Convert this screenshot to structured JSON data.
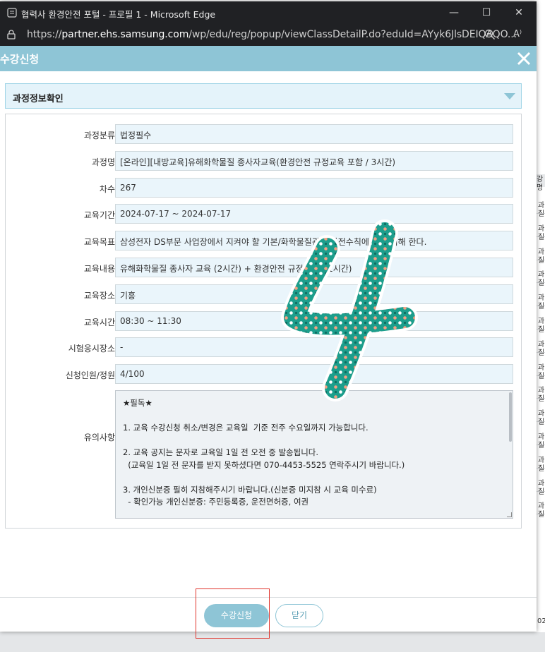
{
  "background": {
    "right_edge_rows": [
      "과질",
      "과질",
      "과질",
      "과질",
      "과질",
      "과질",
      "과질",
      "과질",
      "과질",
      "과질",
      "과질",
      "과질",
      "과질",
      "과질"
    ],
    "right_edge_header": "강명",
    "bottom_right_text": "02"
  },
  "window": {
    "title": "협력사 환경안전 포털 - 프로필 1 - Microsoft Edge",
    "url_prefix": "https://",
    "url_host": "partner.ehs.samsung.com",
    "url_path": "/wp/edu/reg/popup/viewClassDetailP.do?eduId=AYyk6JlsDEIQAQO...",
    "controls": {
      "minimize": "—",
      "maximize": "☐",
      "close": "✕"
    },
    "read_aloud": "A⁾"
  },
  "popup": {
    "title": "수강신청",
    "section_title": "과정정보확인",
    "fields": [
      {
        "label": "과정분류",
        "value": "법정필수"
      },
      {
        "label": "과정명",
        "value": "[온라인][내방교육]유해화학물질 종사자교육(환경안전 규정교육 포함 / 3시간)"
      },
      {
        "label": "차수",
        "value": "267"
      },
      {
        "label": "교육기간",
        "value": "2024-07-17 ~ 2024-07-17"
      },
      {
        "label": "교육목표",
        "value": "삼성전자 DS부문 사업장에서 지켜야 할 기본/화학물질관련 안전수칙에 대해 이해 한다."
      },
      {
        "label": "교육내용",
        "value": "유해화학물질 종사자 교육 (2시간) + 환경안전 규정 교육 (1시간)"
      },
      {
        "label": "교육장소",
        "value": "기흥"
      },
      {
        "label": "교육시간",
        "value": "08:30 ~ 11:30"
      },
      {
        "label": "시험응시장소",
        "value": "-"
      },
      {
        "label": "신청인원/정원",
        "value": "4/100"
      }
    ],
    "notice_label": "유의사항",
    "notice_lines": [
      "★필독★",
      "",
      "1. 교육 수강신청 취소/변경은 교육일  기준 전주 수요일까지 가능합니다.",
      "",
      "2. 교육 공지는 문자로 교육일 1일 전 오전 중 발송됩니다.",
      "  (교육일 1일 전 문자를 받지 못하셨다면 070-4453-5525 연락주시기 바랍니다.)",
      "",
      "3. 개인신분증 필히 지참해주시기 바랍니다.(신분증 미지참 시 교육 미수료)",
      "  - 확인가능 개인신분증: 주민등록증, 운전면허증, 여권"
    ],
    "apply_button": "수강신청",
    "close_button": "닫기"
  },
  "annotations": {
    "sticker_text": "4",
    "highlight_color": "#e0332b"
  },
  "colors": {
    "accent": "#8ec5d6",
    "field_bg": "#eaf5fb",
    "section_bg": "#e4f3fa",
    "titlebar": "#202124"
  }
}
